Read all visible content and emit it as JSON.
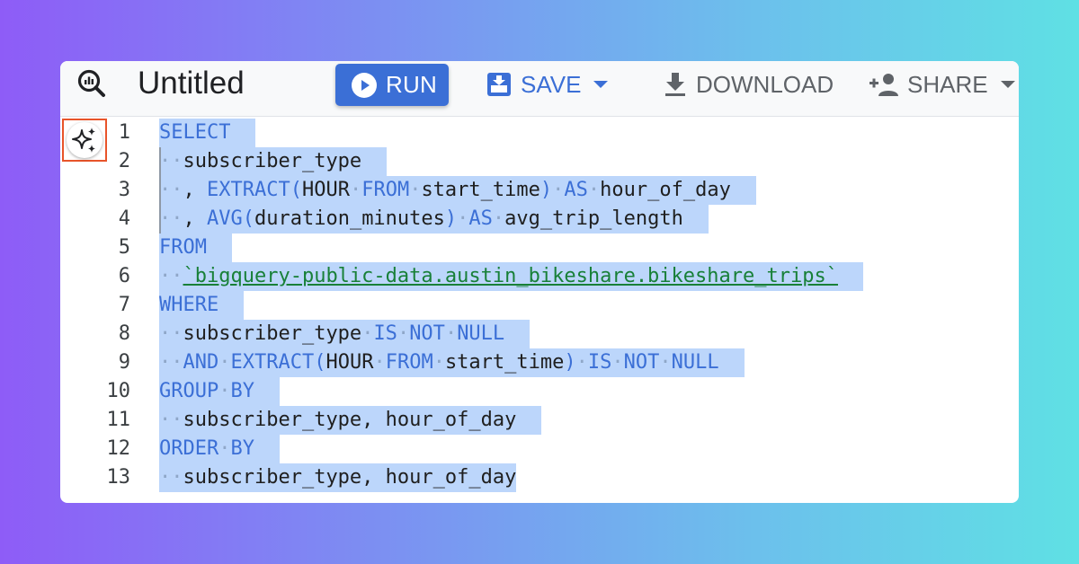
{
  "toolbar": {
    "title": "Untitled",
    "run_label": "RUN",
    "save_label": "SAVE",
    "download_label": "DOWNLOAD",
    "share_label": "SHARE"
  },
  "colors": {
    "accent": "#3b6fd6",
    "selection": "#bcd6fb",
    "string": "#188038",
    "highlight_border": "#e8542a"
  },
  "icons": {
    "app": "bigquery-magnifier-icon",
    "run": "play-circle-icon",
    "save": "save-icon",
    "download": "download-icon",
    "share": "person-add-icon",
    "gutter": "sparkle-icon"
  },
  "editor": {
    "lines": [
      {
        "n": "1",
        "tokens": [
          [
            "kw",
            "SELECT"
          ]
        ]
      },
      {
        "n": "2",
        "tokens": [
          [
            "dot",
            "··"
          ],
          [
            "",
            "subscriber_type"
          ]
        ]
      },
      {
        "n": "3",
        "tokens": [
          [
            "dot",
            "··"
          ],
          [
            "",
            ", "
          ],
          [
            "kw",
            "EXTRACT("
          ],
          [
            "",
            "HOUR"
          ],
          [
            "dot",
            "·"
          ],
          [
            "kw",
            "FROM"
          ],
          [
            "dot",
            "·"
          ],
          [
            "",
            "start_time"
          ],
          [
            "kw",
            ")"
          ],
          [
            "dot",
            "·"
          ],
          [
            "kw",
            "AS"
          ],
          [
            "dot",
            "·"
          ],
          [
            "",
            "hour_of_day"
          ]
        ]
      },
      {
        "n": "4",
        "tokens": [
          [
            "dot",
            "··"
          ],
          [
            "",
            ", "
          ],
          [
            "kw",
            "AVG("
          ],
          [
            "",
            "duration_minutes"
          ],
          [
            "kw",
            ")"
          ],
          [
            "dot",
            "·"
          ],
          [
            "kw",
            "AS"
          ],
          [
            "dot",
            "·"
          ],
          [
            "",
            "avg_trip_length"
          ]
        ]
      },
      {
        "n": "5",
        "tokens": [
          [
            "kw",
            "FROM"
          ]
        ]
      },
      {
        "n": "6",
        "tokens": [
          [
            "dot",
            "··"
          ],
          [
            "str",
            "`bigquery-public-data.austin_bikeshare.bikeshare_trips`"
          ]
        ]
      },
      {
        "n": "7",
        "tokens": [
          [
            "kw",
            "WHERE"
          ]
        ]
      },
      {
        "n": "8",
        "tokens": [
          [
            "dot",
            "··"
          ],
          [
            "",
            "subscriber_type"
          ],
          [
            "dot",
            "·"
          ],
          [
            "kw",
            "IS"
          ],
          [
            "dot",
            "·"
          ],
          [
            "kw",
            "NOT"
          ],
          [
            "dot",
            "·"
          ],
          [
            "kw",
            "NULL"
          ]
        ]
      },
      {
        "n": "9",
        "tokens": [
          [
            "dot",
            "··"
          ],
          [
            "kw",
            "AND"
          ],
          [
            "dot",
            "·"
          ],
          [
            "kw",
            "EXTRACT("
          ],
          [
            "",
            "HOUR"
          ],
          [
            "dot",
            "·"
          ],
          [
            "kw",
            "FROM"
          ],
          [
            "dot",
            "·"
          ],
          [
            "",
            "start_time"
          ],
          [
            "kw",
            ")"
          ],
          [
            "dot",
            "·"
          ],
          [
            "kw",
            "IS"
          ],
          [
            "dot",
            "·"
          ],
          [
            "kw",
            "NOT"
          ],
          [
            "dot",
            "·"
          ],
          [
            "kw",
            "NULL"
          ]
        ]
      },
      {
        "n": "10",
        "tokens": [
          [
            "kw",
            "GROUP"
          ],
          [
            "dot",
            "·"
          ],
          [
            "kw",
            "BY"
          ]
        ]
      },
      {
        "n": "11",
        "tokens": [
          [
            "dot",
            "··"
          ],
          [
            "",
            "subscriber_type, "
          ],
          [
            "",
            "hour_of_day"
          ]
        ]
      },
      {
        "n": "12",
        "tokens": [
          [
            "kw",
            "ORDER"
          ],
          [
            "dot",
            "·"
          ],
          [
            "kw",
            "BY"
          ]
        ]
      },
      {
        "n": "13",
        "tokens": [
          [
            "dot",
            "··"
          ],
          [
            "",
            "subscriber_type, "
          ],
          [
            "",
            "hour_of_day"
          ]
        ]
      }
    ]
  }
}
